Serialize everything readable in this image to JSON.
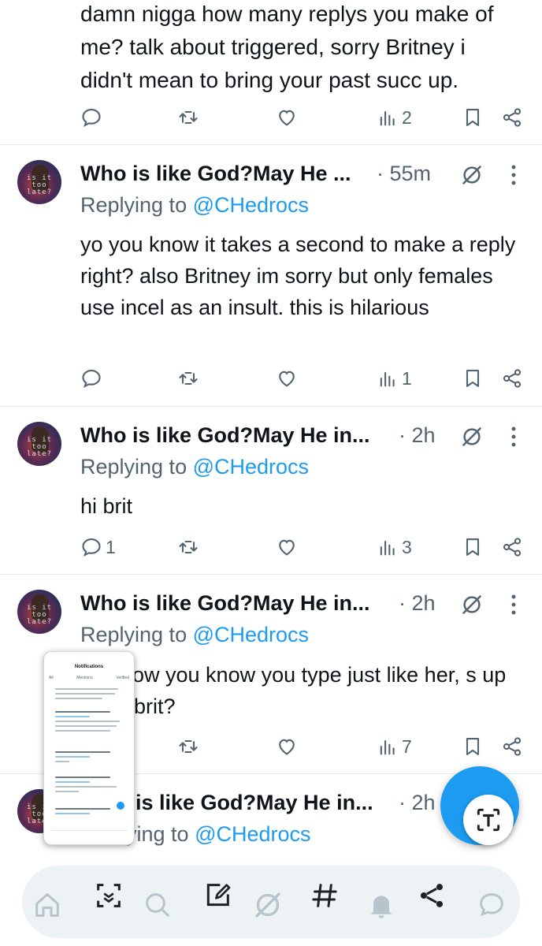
{
  "top_tweet": {
    "body": "damn nigga how many replys you make of me? talk about triggered, sorry Britney i didn't mean to bring your past succ up.",
    "actions": {
      "replies": "",
      "retweets": "",
      "likes": "",
      "views": "2"
    }
  },
  "tweets": [
    {
      "avatar_text": "is it too late?",
      "name": "Who is like God?May He ...",
      "time": "· 55m",
      "replying_prefix": "Replying to ",
      "replying_handle": "@CHedrocs",
      "body": "yo you know it takes a second to make a reply right? also Britney im sorry but only females use incel as an insult. this is hilarious",
      "actions": {
        "replies": "",
        "retweets": "",
        "likes": "",
        "views": "1"
      }
    },
    {
      "avatar_text": "is it too late?",
      "name": "Who is like God?May He in...",
      "time": "· 2h",
      "replying_prefix": "Replying to ",
      "replying_handle": "@CHedrocs",
      "body": "hi brit",
      "actions": {
        "replies": "1",
        "retweets": "",
        "likes": "",
        "views": "3"
      }
    },
    {
      "avatar_text": "is it too late?",
      "name": "Who is like God?May He in...",
      "time": "· 2h",
      "replying_prefix": "Replying to ",
      "replying_handle": "@CHedrocs",
      "body": "ow you know you type just like her, s up brit?",
      "actions": {
        "replies": "",
        "retweets": "",
        "likes": "",
        "views": "7"
      }
    },
    {
      "avatar_text": "is it too late?",
      "name": "is like God?May He in...",
      "time": "· 2h",
      "replying_prefix": "ying to ",
      "replying_handle": "@CHedrocs",
      "body": "",
      "actions": {
        "replies": "",
        "retweets": "",
        "likes": "",
        "views": ""
      }
    }
  ],
  "pip": {
    "title": "Notifications",
    "tabs": [
      "All",
      "Mentions",
      "Verified"
    ]
  },
  "bottom_nav": [
    "home-icon",
    "scan-icon",
    "search-icon",
    "compose-icon",
    "grok-icon",
    "hashtag-icon",
    "bell-icon",
    "share-icon",
    "chat-icon"
  ],
  "colors": {
    "accent": "#1d9bf0",
    "text": "#0f1419",
    "muted": "#536471",
    "divider": "#e6e9ec"
  }
}
